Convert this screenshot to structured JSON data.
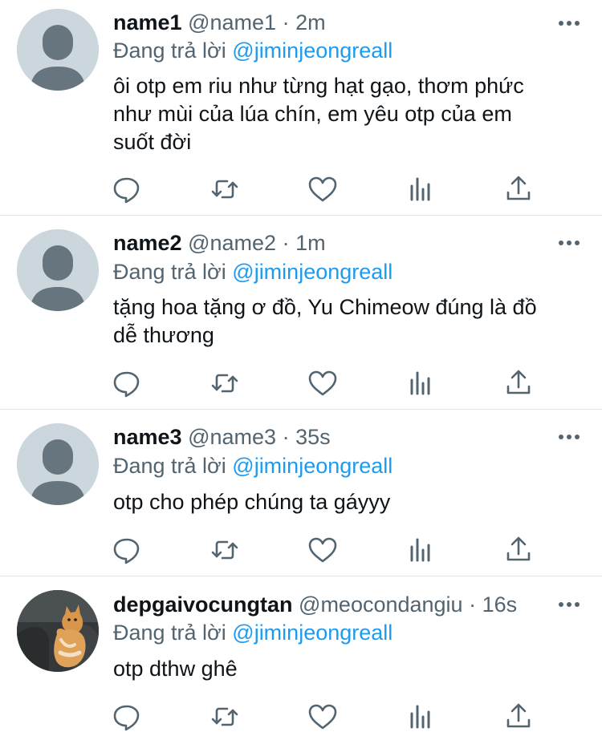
{
  "tweets": [
    {
      "name": "name1",
      "handle": "@name1",
      "time": "2m",
      "replying_prefix": "Đang trả lời",
      "replying_to": "@jiminjeongreall",
      "text_lines": [
        "ôi otp em riu như từng hạt gạo, thơm phức",
        "như mùi của lúa chín, em yêu otp của em",
        "suốt đời"
      ],
      "avatar": "default-avatar"
    },
    {
      "name": "name2",
      "handle": "@name2",
      "time": "1m",
      "replying_prefix": "Đang trả lời",
      "replying_to": "@jiminjeongreall",
      "text_lines": [
        "tặng hoa tặng ơ đồ, Yu Chimeow đúng là đồ",
        "dễ thương"
      ],
      "avatar": "default-avatar"
    },
    {
      "name": "name3",
      "handle": "@name3",
      "time": "35s",
      "replying_prefix": "Đang trả lời",
      "replying_to": "@jiminjeongreall",
      "text_lines": [
        "otp cho phép chúng ta gáyyy"
      ],
      "avatar": "default-avatar"
    },
    {
      "name": "depgaivocungtan",
      "handle": "@meocondangiu",
      "time": "16s",
      "replying_prefix": "Đang trả lời",
      "replying_to": "@jiminjeongreall",
      "text_lines": [
        "otp dthw ghê"
      ],
      "avatar": "cat-photo-avatar"
    }
  ],
  "separator": "·",
  "icons": {
    "more": "more-horizontal-icon",
    "reply": "reply-icon",
    "retweet": "retweet-icon",
    "like": "heart-icon",
    "views": "analytics-icon",
    "share": "share-icon"
  },
  "colors": {
    "link": "#1d9bf0",
    "secondary_text": "#536471",
    "avatar_placeholder": "#ccd6dd",
    "avatar_figure": "#67757f",
    "divider": "#dfe3e7"
  }
}
